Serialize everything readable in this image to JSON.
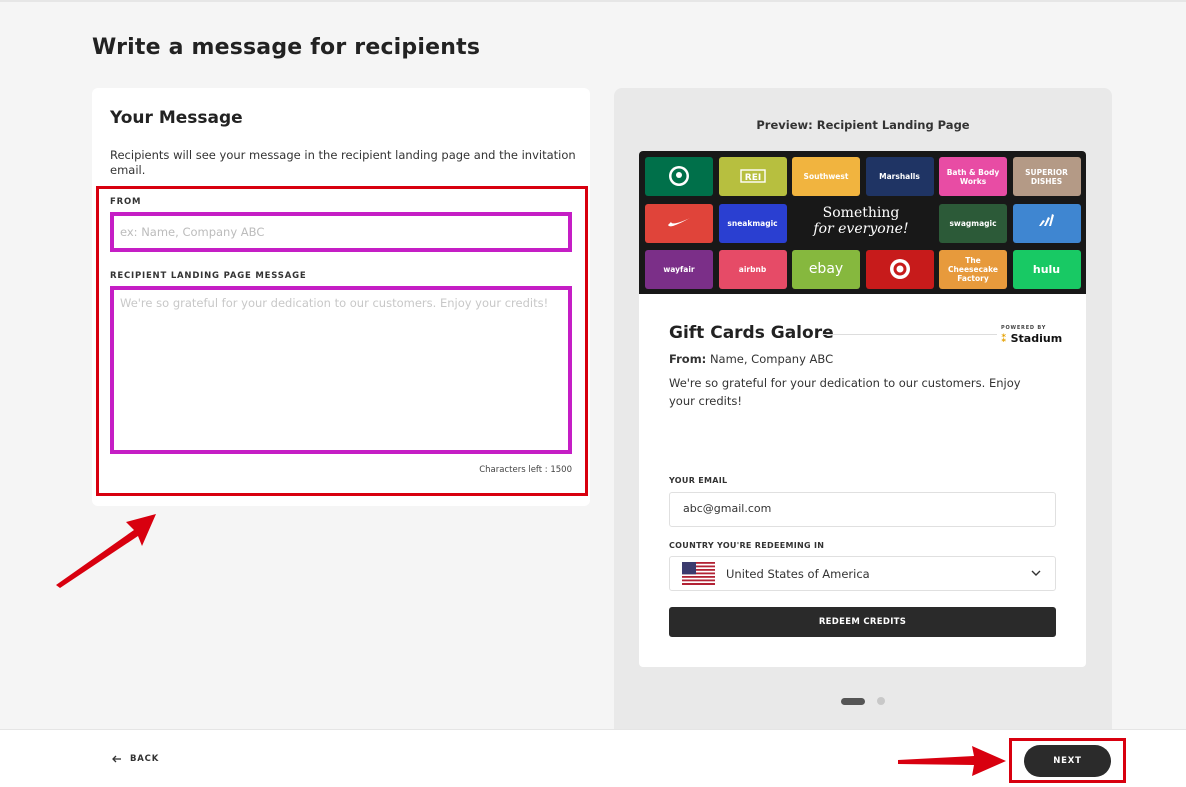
{
  "page": {
    "title": "Write a message for recipients"
  },
  "message_card": {
    "title": "Your Message",
    "description": "Recipients will see your message in the recipient landing page and the invitation email.",
    "from_label": "FROM",
    "from_placeholder": "ex: Name, Company ABC",
    "from_value": "",
    "message_label": "RECIPIENT LANDING PAGE MESSAGE",
    "message_placeholder": "We're so grateful for your dedication to our customers. Enjoy your credits!",
    "message_value": "",
    "characters_left": "Characters left : 1500",
    "highlight_color": "#d8000f",
    "focus_color": "#c51ec5"
  },
  "preview": {
    "title": "Preview: Recipient Landing Page",
    "hero_line1": "Something",
    "hero_line2": "for everyone!",
    "tiles": [
      {
        "label": "",
        "color": "#00704a",
        "icon": "starbucks-logo-icon"
      },
      {
        "label": "REI",
        "color": "#b7bf3f",
        "icon": "rei-logo-icon"
      },
      {
        "label": "Southwest",
        "color": "#f1b43f"
      },
      {
        "label": "Marshalls",
        "color": "#1f3464"
      },
      {
        "label": "Bath & Body Works",
        "color": "#e84ca4"
      },
      {
        "label": "SUPERIOR DISHES",
        "color": "#b49a86"
      },
      {
        "label": "",
        "color": "#e0443a",
        "icon": "nike-swoosh-icon"
      },
      {
        "label": "sneakmagic",
        "color": "#2a3fd1"
      },
      {
        "label": "swagmagic",
        "color": "#2c5a38"
      },
      {
        "label": "adidas",
        "color": "#3f86d1",
        "icon": "adidas-logo-icon"
      },
      {
        "label": "wayfair",
        "color": "#7b2f88"
      },
      {
        "label": "airbnb",
        "color": "#e64b67"
      },
      {
        "label": "ebay",
        "color": "#86b83e"
      },
      {
        "label": "",
        "color": "#c71b1b",
        "icon": "target-logo-icon"
      },
      {
        "label": "The Cheesecake Factory",
        "color": "#e79a3c"
      },
      {
        "label": "hulu",
        "color": "#18c964"
      }
    ],
    "gift_title": "Gift Cards Galore",
    "powered_by": "POWERED BY",
    "brand": "Stadium",
    "from_prefix": "From:",
    "from_value": "Name, Company ABC",
    "message": "We're so grateful for your dedication to our customers. Enjoy your credits!",
    "email_label": "YOUR EMAIL",
    "email_value": "abc@gmail.com",
    "country_label": "COUNTRY YOU'RE REDEEMING IN",
    "country_value": "United States of America",
    "redeem_label": "REDEEM CREDITS",
    "pager_pages": 2,
    "pager_active": 1
  },
  "footer": {
    "back_label": "BACK",
    "next_label": "NEXT"
  }
}
